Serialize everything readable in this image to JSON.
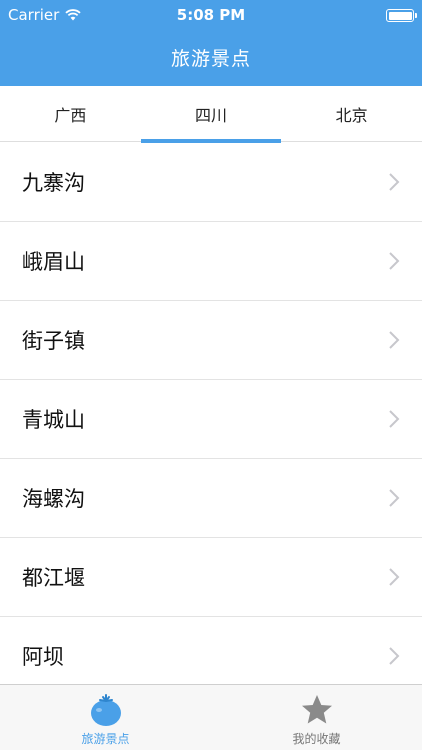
{
  "status_bar": {
    "carrier": "Carrier",
    "time": "5:08 PM",
    "wifi_icon": "wifi-icon",
    "battery_icon": "battery-icon"
  },
  "nav": {
    "title": "旅游景点"
  },
  "tabs": [
    {
      "label": "广西",
      "active": false
    },
    {
      "label": "四川",
      "active": true
    },
    {
      "label": "北京",
      "active": false
    }
  ],
  "list": {
    "items": [
      {
        "label": "九寨沟"
      },
      {
        "label": "峨眉山"
      },
      {
        "label": "街子镇"
      },
      {
        "label": "青城山"
      },
      {
        "label": "海螺沟"
      },
      {
        "label": "都江堰"
      },
      {
        "label": "阿坝"
      }
    ],
    "chevron_icon": "chevron-right-icon"
  },
  "tab_bar": {
    "items": [
      {
        "label": "旅游景点",
        "icon": "tomato-icon",
        "active": true
      },
      {
        "label": "我的收藏",
        "icon": "star-icon",
        "active": false
      }
    ]
  },
  "colors": {
    "accent": "#4aa0e8",
    "inactive": "#777777"
  }
}
